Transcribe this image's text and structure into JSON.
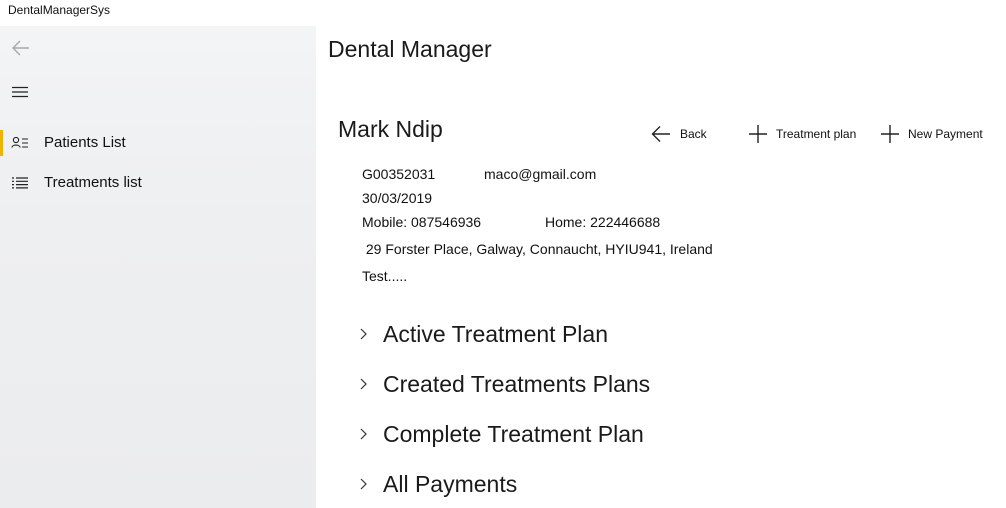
{
  "window": {
    "title": "DentalManagerSys"
  },
  "nav": {
    "items": [
      {
        "label": "Patients List",
        "icon": "contact-list-icon",
        "selected": true
      },
      {
        "label": "Treatments list",
        "icon": "bulleted-list-icon",
        "selected": false
      }
    ],
    "accent": "#f0b400"
  },
  "header": {
    "title": "Dental Manager"
  },
  "patient": {
    "name": "Mark Ndip",
    "id": "G00352031",
    "email": "maco@gmail.com",
    "date": "30/03/2019",
    "mobile": "Mobile: 087546936",
    "home": "Home: 222446688",
    "address": " 29 Forster Place, Galway, Connaucht, HYIU941, Ireland",
    "notes": "Test....."
  },
  "commands": {
    "back": "Back",
    "treatment_plan": "Treatment plan",
    "new_payment": "New Payment"
  },
  "sections": [
    {
      "label": "Active Treatment Plan"
    },
    {
      "label": "Created Treatments Plans"
    },
    {
      "label": "Complete Treatment Plan"
    },
    {
      "label": "All Payments"
    }
  ]
}
